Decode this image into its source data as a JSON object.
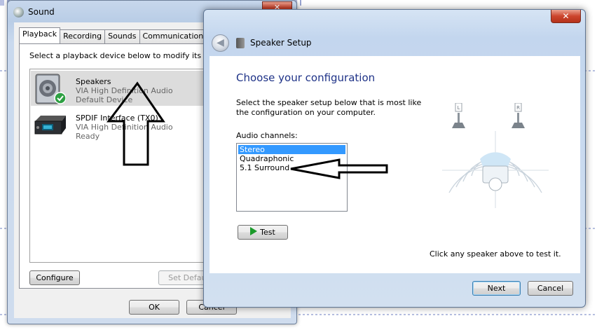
{
  "background": {
    "fragments": []
  },
  "sound_dialog": {
    "title": "Sound",
    "close_label": "✕",
    "tabs": [
      {
        "label": "Playback"
      },
      {
        "label": "Recording"
      },
      {
        "label": "Sounds"
      },
      {
        "label": "Communications"
      }
    ],
    "hint": "Select a playback device below to modify its settings:",
    "devices": [
      {
        "name": "Speakers",
        "driver": "VIA High Definition Audio",
        "status": "Default Device",
        "icon": "speaker-icon",
        "selected": true
      },
      {
        "name": "SPDIF Interface (TX0)",
        "driver": "VIA High Definition Audio",
        "status": "Ready",
        "icon": "spdif-device-icon",
        "selected": false
      }
    ],
    "configure_label": "Configure",
    "set_default_label": "Set Default",
    "ok_label": "OK",
    "cancel_label": "Cancel"
  },
  "speaker_setup": {
    "title": "Speaker Setup",
    "close_label": "✕",
    "heading": "Choose your configuration",
    "description": "Select the speaker setup below that is most like the configuration on your computer.",
    "channels_label": "Audio channels:",
    "channels": [
      {
        "label": "Stereo",
        "selected": true
      },
      {
        "label": "Quadraphonic",
        "selected": false
      },
      {
        "label": "5.1 Surround",
        "selected": false
      }
    ],
    "test_label": "Test",
    "speaker_labels": {
      "left": "L",
      "right": "R"
    },
    "speaker_hint": "Click any speaker above to test it.",
    "next_label": "Next",
    "cancel_label": "Cancel"
  }
}
